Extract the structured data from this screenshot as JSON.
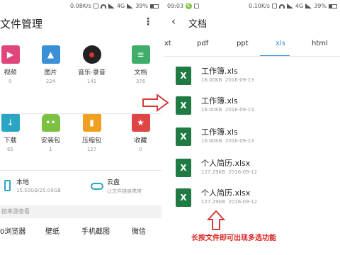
{
  "left": {
    "status": {
      "speed": "0.08K/s",
      "network": "4G",
      "battery": "39%"
    },
    "title": "文件管理",
    "categories": [
      {
        "label": "视频",
        "count": "0",
        "icon": "video-icon",
        "color": "#e0457b"
      },
      {
        "label": "图片",
        "count": "224",
        "icon": "image-icon",
        "color": "#3b8fd6"
      },
      {
        "label": "音乐·录音",
        "count": "141",
        "icon": "music-disc-icon",
        "color": "#222222"
      },
      {
        "label": "文档",
        "count": "376",
        "icon": "document-icon",
        "color": "#3fae6a"
      },
      {
        "label": "下载",
        "count": "65",
        "icon": "download-icon",
        "color": "#2aa5c4"
      },
      {
        "label": "安装包",
        "count": "1",
        "icon": "android-icon",
        "color": "#7cc142"
      },
      {
        "label": "压缩包",
        "count": "127",
        "icon": "zip-icon",
        "color": "#f0a020"
      },
      {
        "label": "收藏",
        "count": "0",
        "icon": "bookmark-star-icon",
        "color": "#e04545"
      }
    ],
    "storage": {
      "local": {
        "name": "本地",
        "size": "15.50GB/25.09GB"
      },
      "cloud": {
        "name": "云盘",
        "desc": "让文件随身携带"
      }
    },
    "section_label": "按来源查看",
    "apps": [
      "0浏览器",
      "壁纸",
      "手机截图",
      "微信"
    ]
  },
  "right": {
    "status": {
      "time": "09:03",
      "speed": "0.10K/s",
      "network": "4G",
      "battery": "39%"
    },
    "title": "文档",
    "tabs": [
      "xt",
      "pdf",
      "ppt",
      "xls",
      "html"
    ],
    "active_tab": "xls",
    "files": [
      {
        "name": "工作簿.xls",
        "size": "16.00KB",
        "date": "2016-09-13"
      },
      {
        "name": "工作簿.xls",
        "size": "16.00KB",
        "date": "2016-09-13"
      },
      {
        "name": "工作簿.xls",
        "size": "16.00KB",
        "date": "2016-09-13"
      },
      {
        "name": "个人简历.xlsx",
        "size": "127.29KB",
        "date": "2016-09-12"
      },
      {
        "name": "个人简历.xlsx",
        "size": "127.29KB",
        "date": "2016-09-12"
      }
    ],
    "file_icon_letter": "X",
    "note": "长按文件即可出现多选功能"
  },
  "colors": {
    "accent": "#3b8fd6",
    "excel": "#1f7a43",
    "note": "#dd2222",
    "arrow": "#d23b3b"
  }
}
